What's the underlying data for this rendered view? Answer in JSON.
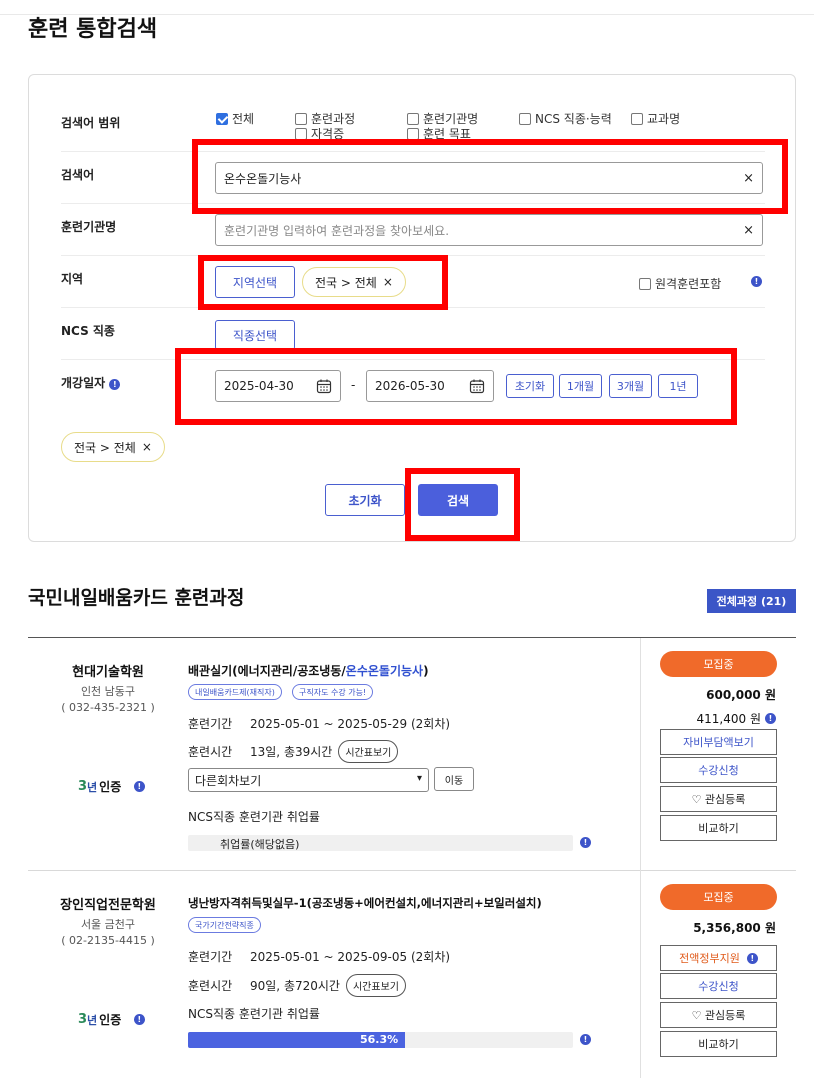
{
  "page": {
    "title": "훈련 통합검색"
  },
  "search": {
    "scope_label": "검색어 범위",
    "scopes": [
      {
        "label": "전체",
        "checked": true
      },
      {
        "label": "훈련과정",
        "checked": false
      },
      {
        "label": "훈련기관명",
        "checked": false
      },
      {
        "label": "NCS 직종·능력",
        "checked": false
      },
      {
        "label": "교과명",
        "checked": false
      },
      {
        "label": "자격증",
        "checked": false
      },
      {
        "label": "훈련 목표",
        "checked": false
      }
    ],
    "keyword_label": "검색어",
    "keyword_value": "온수온돌기능사",
    "institution_label": "훈련기관명",
    "institution_placeholder": "훈련기관명 입력하여 훈련과정을 찾아보세요.",
    "region_label": "지역",
    "region_button": "지역선택",
    "region_chip": "전국 > 전체",
    "remote_label": "원격훈련포함",
    "ncs_label": "NCS 직종",
    "ncs_button": "직종선택",
    "date_label": "개강일자",
    "date_start": "2025-04-30",
    "date_sep": "-",
    "date_end": "2026-05-30",
    "date_quick": [
      "초기화",
      "1개월",
      "3개월",
      "1년"
    ],
    "selected_chip": "전국 > 전체",
    "reset_button": "초기화",
    "search_button": "검색",
    "clear_symbol": "×",
    "info_symbol": "!"
  },
  "results": {
    "section_title": "국민내일배움카드 훈련과정",
    "all_button": "전체과정 (21)",
    "cert_num": "3",
    "cert_nyeon": "년",
    "cert_text": "인증",
    "courses": [
      {
        "institution": "현대기술학원",
        "location": "인천 남동구",
        "phone": "( 032-435-2321 )",
        "title_prefix": "배관실기(에너지관리/공조냉동/",
        "title_highlight": "온수온돌기능사",
        "title_suffix": ")",
        "tags": [
          "내일배움카드제(재직자)",
          "구직자도 수강 가능!"
        ],
        "period_label": "훈련기간",
        "period": "2025-05-01 ~ 2025-05-29 (2회차)",
        "hours_label": "훈련시간",
        "hours": "13일, 총39시간",
        "timetable_button": "시간표보기",
        "round_select": "다른회차보기",
        "move_button": "이동",
        "employment_label": "NCS직종 훈련기관 취업률",
        "employment_rate": 0,
        "employment_text": "취업률(해당없음)",
        "status": "모집중",
        "price": "600,000 원",
        "self_pay": "411,400 원",
        "buttons": [
          "자비부담액보기",
          "수강신청",
          "♡ 관심등록",
          "비교하기"
        ]
      },
      {
        "institution": "장인직업전문학원",
        "location": "서울 금천구",
        "phone": "( 02-2135-4415 )",
        "title": "냉난방자격취득및실무-1(공조냉동+에어컨설치,에너지관리+보일러설치)",
        "tags": [
          "국가기간전략직종"
        ],
        "period_label": "훈련기간",
        "period": "2025-05-01 ~ 2025-09-05 (2회차)",
        "hours_label": "훈련시간",
        "hours": "90일, 총720시간",
        "timetable_button": "시간표보기",
        "employment_label": "NCS직종 훈련기관 취업률",
        "employment_rate": 0.563,
        "employment_text": "56.3%",
        "status": "모집중",
        "price": "5,356,800 원",
        "buttons": [
          "전액정부지원",
          "수강신청",
          "♡ 관심등록",
          "비교하기"
        ]
      }
    ]
  }
}
